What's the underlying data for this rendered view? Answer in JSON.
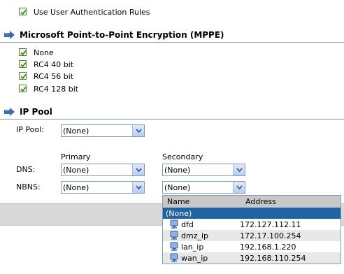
{
  "auth": {
    "use_user_auth_rules": "Use User Authentication Rules",
    "checked": true
  },
  "mppe": {
    "title": "Microsoft Point-to-Point Encryption (MPPE)",
    "options": [
      {
        "label": "None",
        "checked": true
      },
      {
        "label": "RC4 40 bit",
        "checked": true
      },
      {
        "label": "RC4 56 bit",
        "checked": true
      },
      {
        "label": "RC4 128 bit",
        "checked": true
      }
    ]
  },
  "ippool": {
    "title": "IP Pool",
    "pool_label": "IP Pool:",
    "pool_value": "(None)",
    "primary_header": "Primary",
    "secondary_header": "Secondary",
    "dns_label": "DNS:",
    "dns_primary": "(None)",
    "dns_secondary": "(None)",
    "nbns_label": "NBNS:",
    "nbns_primary": "(None)",
    "nbns_secondary": "(None)"
  },
  "dropdown": {
    "col_name": "Name",
    "col_address": "Address",
    "items": [
      {
        "name": "(None)",
        "address": ""
      },
      {
        "name": "dfd",
        "address": "172.127.112.11"
      },
      {
        "name": "dmz_ip",
        "address": "172.17.100.254"
      },
      {
        "name": "lan_ip",
        "address": "192.168.1.220"
      },
      {
        "name": "wan_ip",
        "address": "192.168.110.254"
      }
    ]
  },
  "colors": {
    "selected_row": "#1f63a3",
    "check_green": "#3a8a1a",
    "combo_border": "#7f9db9"
  }
}
